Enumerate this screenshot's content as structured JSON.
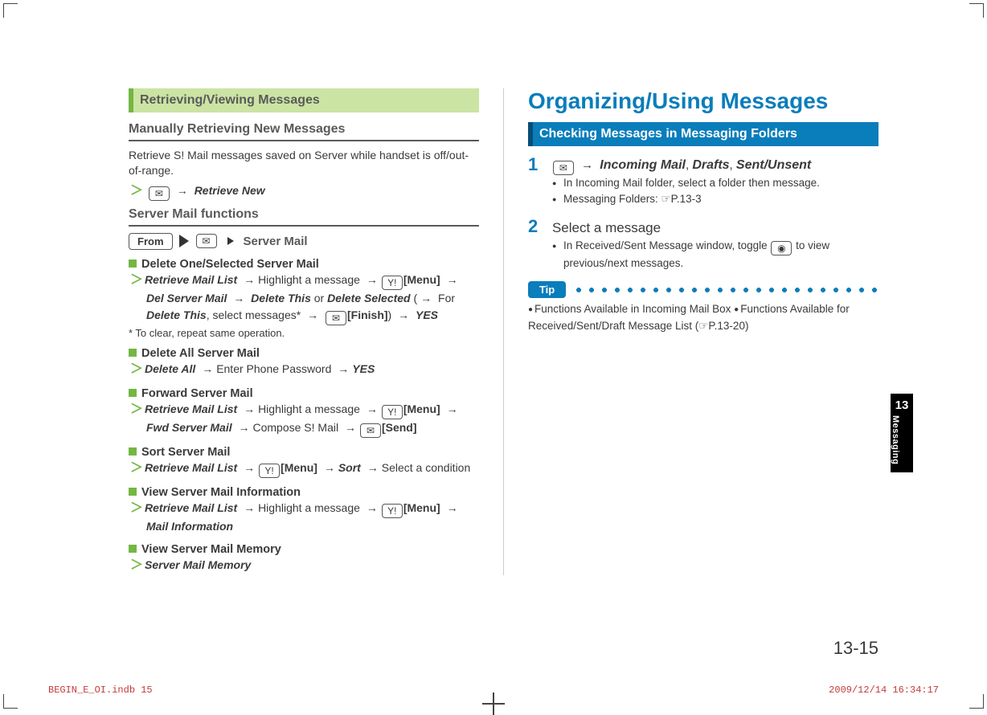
{
  "left": {
    "section_title": "Retrieving/Viewing Messages",
    "sub1": "Manually Retrieving New Messages",
    "intro": "Retrieve S! Mail messages saved on Server while handset is off/out-of-range.",
    "retrieve_new": "Retrieve New",
    "sub2": "Server Mail functions",
    "from_label": "From",
    "server_mail_label": "Server Mail",
    "items": [
      {
        "title": "Delete One/Selected Server Mail",
        "lines": "Del Server Mail → Delete This or Delete Selected (→ For Delete This, select messages* →",
        "retrieve": "Retrieve Mail List",
        "highlight": "Highlight a message",
        "menu": "[Menu]",
        "finish": "[Finish]",
        "yes": "YES",
        "note": "* To clear, repeat same operation."
      }
    ],
    "delete_all_title": "Delete All Server Mail",
    "delete_all_action": "Delete All",
    "enter_pw": "Enter Phone Password",
    "yes": "YES",
    "forward_title": "Forward Server Mail",
    "retrieve_list": "Retrieve Mail List",
    "highlight_msg": "Highlight a message",
    "menu": "[Menu]",
    "fwd_server": "Fwd Server Mail",
    "compose": "Compose S! Mail",
    "send": "[Send]",
    "sort_title": "Sort Server Mail",
    "sort": "Sort",
    "select_cond": "Select a condition",
    "view_info_title": "View Server Mail Information",
    "mail_info": "Mail Information",
    "view_mem_title": "View Server Mail Memory",
    "server_mem": "Server Mail Memory"
  },
  "right": {
    "h1": "Organizing/Using Messages",
    "section_title": "Checking Messages in Messaging Folders",
    "step1_nav": "Incoming Mail, Drafts, Sent/Unsent",
    "step1_b1": "In Incoming Mail folder, select a folder then message.",
    "step1_b2_pre": "Messaging Folders: ",
    "step1_b2_ref": "P.13-3",
    "step2_title": "Select a message",
    "step2_b1": "In Received/Sent Message window, toggle",
    "step2_b1_after": "to view previous/next messages.",
    "tip_label": "Tip",
    "tip_body_a": "Functions Available in Incoming Mail Box",
    "tip_body_b": "Functions Available for Received/Sent/Draft Message List (",
    "tip_ref": "P.13-20",
    "tip_close": ")"
  },
  "chapter_num": "13",
  "chapter_label": "Messaging",
  "page_number": "13-15",
  "footer_left": "BEGIN_E_OI.indb   15",
  "footer_right": "2009/12/14   16:34:17"
}
